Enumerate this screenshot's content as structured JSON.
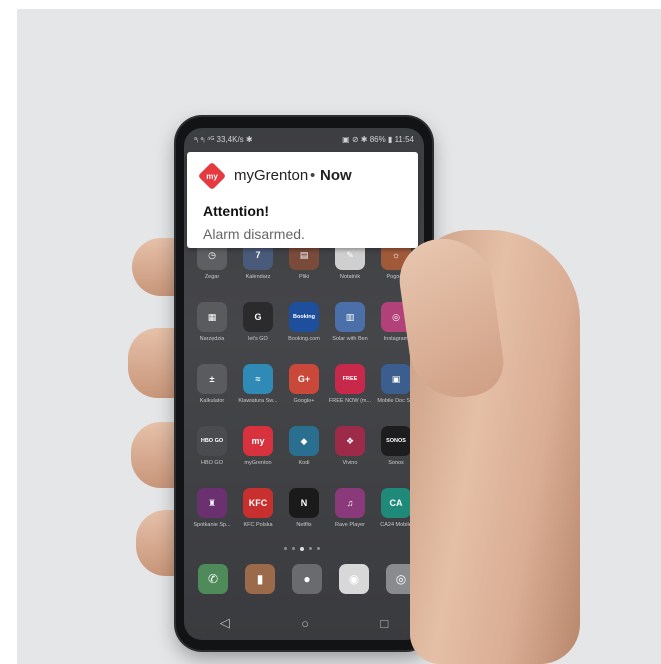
{
  "status_bar": {
    "left": "ᵃᵢ ᵃᵢ ⁴ᴳ 33,4K/s ✱",
    "right": "▣ ⊘ ✱ 86% ▮ 11:54"
  },
  "notification": {
    "logo_text": "my",
    "app_name": "myGrenton",
    "separator": "•",
    "time": "Now",
    "title": "Attention!",
    "body": "Alarm disarmed."
  },
  "apps": [
    {
      "label": "Zegar",
      "color": "#5e5f62",
      "glyph": "◷"
    },
    {
      "label": "Kalendarz",
      "color": "#4a5a7a",
      "glyph": "7"
    },
    {
      "label": "Pliki",
      "color": "#7a4a3a",
      "glyph": "▤"
    },
    {
      "label": "Notatnik",
      "color": "#cfcfcf",
      "glyph": "✎"
    },
    {
      "label": "Pogoda",
      "color": "#a05a3a",
      "glyph": "☼"
    },
    {
      "label": "Narzędzia",
      "color": "#5a5b5e",
      "glyph": "▦"
    },
    {
      "label": "let's GO",
      "color": "#2b2b2d",
      "glyph": "G"
    },
    {
      "label": "Booking.com",
      "color": "#1d4f9c",
      "glyph": "Booking"
    },
    {
      "label": "Solar with Ben",
      "color": "#4b6fa8",
      "glyph": "▥"
    },
    {
      "label": "Instagram",
      "color": "#b2417a",
      "glyph": "◎"
    },
    {
      "label": "Kalkulator",
      "color": "#5a5b5e",
      "glyph": "±"
    },
    {
      "label": "Klawiatura Sw...",
      "color": "#2f8bb5",
      "glyph": "≈"
    },
    {
      "label": "Google+",
      "color": "#c9483a",
      "glyph": "G+"
    },
    {
      "label": "FREE NOW (m...",
      "color": "#c8284a",
      "glyph": "FREE"
    },
    {
      "label": "Mobile Doc S...",
      "color": "#3b5e8e",
      "glyph": "▣"
    },
    {
      "label": "HBO GO",
      "color": "#4a4b4e",
      "glyph": "HBO GO"
    },
    {
      "label": "myGrenton",
      "color": "#d8323e",
      "glyph": "my"
    },
    {
      "label": "Kodi",
      "color": "#2a6f8f",
      "glyph": "◆"
    },
    {
      "label": "Vivino",
      "color": "#9e2a4a",
      "glyph": "❖"
    },
    {
      "label": "Sonos",
      "color": "#1d1d1f",
      "glyph": "SONOS"
    },
    {
      "label": "Spotkanie Sp...",
      "color": "#6a3070",
      "glyph": "♜"
    },
    {
      "label": "KFC Polska",
      "color": "#c82f2f",
      "glyph": "KFC"
    },
    {
      "label": "Netflix",
      "color": "#1a1a1a",
      "glyph": "N"
    },
    {
      "label": "Rave Player",
      "color": "#8a3a7a",
      "glyph": "♫"
    },
    {
      "label": "CA24 Mobile",
      "color": "#1f8a7a",
      "glyph": "CA"
    }
  ],
  "dock": [
    {
      "name": "phone",
      "color": "#4e8a5a",
      "glyph": "✆"
    },
    {
      "name": "contacts",
      "color": "#9a6a4a",
      "glyph": "▮"
    },
    {
      "name": "messages",
      "color": "#6a6b6e",
      "glyph": "●"
    },
    {
      "name": "chrome",
      "color": "#d8d8d8",
      "glyph": "◉"
    },
    {
      "name": "camera",
      "color": "#8a8b8e",
      "glyph": "◎"
    }
  ],
  "nav": {
    "back": "◁",
    "home": "○",
    "recent": "□"
  }
}
